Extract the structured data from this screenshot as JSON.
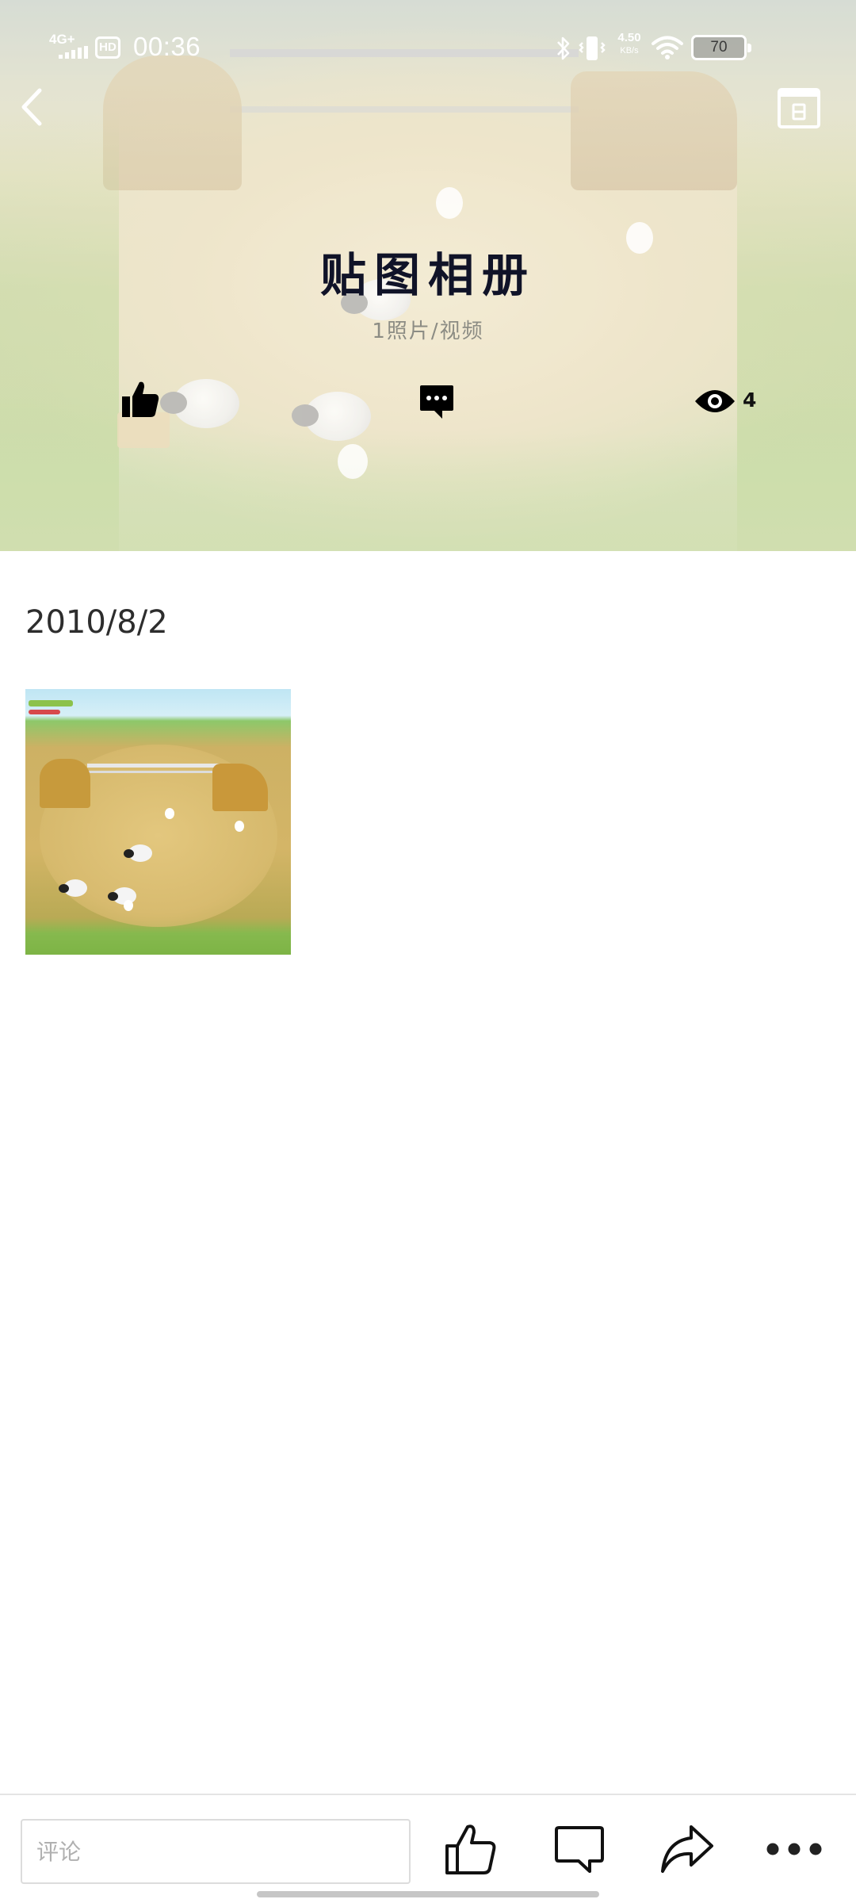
{
  "status_bar": {
    "network": "4G+",
    "hd_label": "HD",
    "time": "00:36",
    "speed_value": "4.50",
    "speed_unit": "KB/s",
    "battery": "70",
    "icons": [
      "signal-icon",
      "bluetooth-icon",
      "vibrate-icon",
      "wifi-icon",
      "battery-icon"
    ]
  },
  "header": {
    "title": "贴图相册",
    "count_text": "1照片/视频",
    "views_count": "4",
    "icons": [
      "back-chevron-icon",
      "calendar-icon",
      "thumbs-up-icon",
      "comment-dots-icon",
      "eye-icon"
    ]
  },
  "content": {
    "groups": [
      {
        "date": "2010/8/2",
        "photos": [
          {
            "name": "farm-game-thumbnail"
          }
        ]
      }
    ]
  },
  "bottom_bar": {
    "comment_placeholder": "评论",
    "comment_value": "",
    "icons": [
      "thumbs-up-outline-icon",
      "comment-outline-icon",
      "share-icon",
      "more-dots-icon"
    ]
  },
  "colors": {
    "title": "#101328",
    "subtitle": "#8c8c84",
    "date_text": "#2d2d2d",
    "divider": "#e4e4e4"
  }
}
